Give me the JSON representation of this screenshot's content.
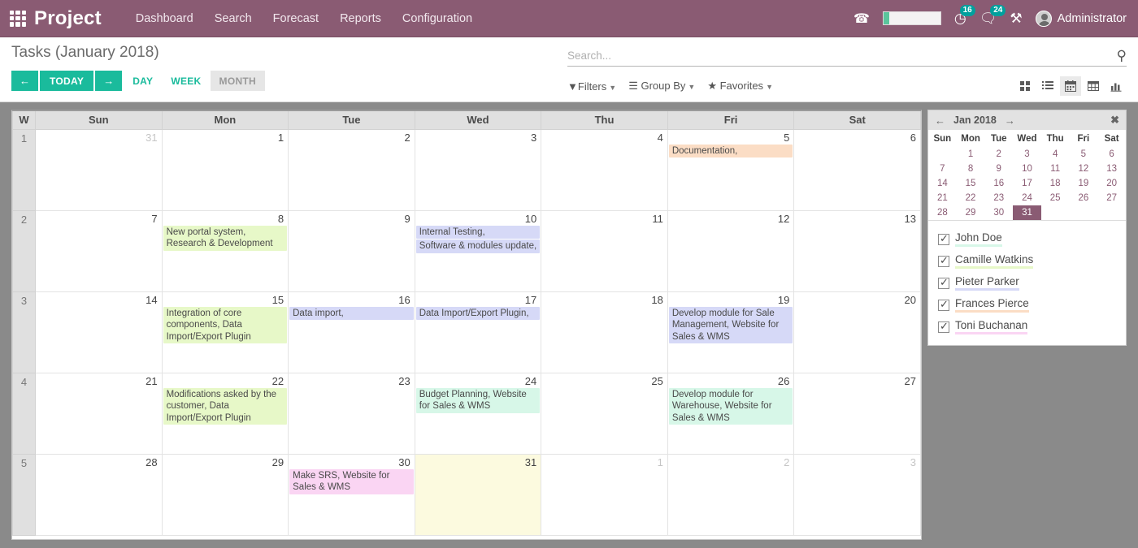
{
  "navbar": {
    "apps_icon": "apps-grid-icon",
    "brand": "Project",
    "links": [
      {
        "label": "Dashboard"
      },
      {
        "label": "Search"
      },
      {
        "label": "Forecast"
      },
      {
        "label": "Reports"
      },
      {
        "label": "Configuration"
      }
    ],
    "phone_icon": "phone-icon",
    "progress": {
      "percent": 10
    },
    "activity": {
      "icon": "clock-icon",
      "count": "16"
    },
    "messages": {
      "icon": "chat-icon",
      "count": "24"
    },
    "tools_icon": "tools-icon",
    "user": "Administrator",
    "brand_color": "#8a5b73",
    "badge_color": "#00a09d"
  },
  "control": {
    "title": "Tasks (January 2018)",
    "prev_label": "←",
    "today_label": "TODAY",
    "next_label": "→",
    "scales": [
      {
        "label": "DAY",
        "active": false
      },
      {
        "label": "WEEK",
        "active": false
      },
      {
        "label": "MONTH",
        "active": true
      }
    ],
    "accent_color": "#1abb9c",
    "search": {
      "placeholder": "Search...",
      "value": "",
      "icon": "search-icon"
    },
    "filters": [
      {
        "label": "Filters",
        "icon": "filter-icon"
      },
      {
        "label": "Group By",
        "icon": "hamburger-icon"
      },
      {
        "label": "Favorites",
        "icon": "star-icon"
      }
    ],
    "views": [
      {
        "name": "kanban",
        "active": false
      },
      {
        "name": "list",
        "active": false
      },
      {
        "name": "calendar",
        "active": true
      },
      {
        "name": "pivot",
        "active": false
      },
      {
        "name": "graph",
        "active": false
      }
    ]
  },
  "calendar": {
    "week_header": "W",
    "day_headers": [
      "Sun",
      "Mon",
      "Tue",
      "Wed",
      "Thu",
      "Fri",
      "Sat"
    ],
    "colors": {
      "mint": "#d7f7e8",
      "green": "#e7f8c8",
      "lavender": "#d6d9f7",
      "peach": "#fbddc5",
      "pink": "#fad5f3",
      "today_bg": "#fcfadf"
    },
    "weeks": [
      {
        "week": "1",
        "days": [
          {
            "num": "31",
            "other": true,
            "today": false,
            "events": []
          },
          {
            "num": "1",
            "other": false,
            "today": false,
            "events": []
          },
          {
            "num": "2",
            "other": false,
            "today": false,
            "events": []
          },
          {
            "num": "3",
            "other": false,
            "today": false,
            "events": []
          },
          {
            "num": "4",
            "other": false,
            "today": false,
            "events": []
          },
          {
            "num": "5",
            "other": false,
            "today": false,
            "events": [
              {
                "text": "Documentation,",
                "color": "peach"
              }
            ]
          },
          {
            "num": "6",
            "other": false,
            "today": false,
            "events": []
          }
        ]
      },
      {
        "week": "2",
        "days": [
          {
            "num": "7",
            "other": false,
            "today": false,
            "events": []
          },
          {
            "num": "8",
            "other": false,
            "today": false,
            "events": [
              {
                "text": "New portal system, Research & Development",
                "color": "green"
              }
            ]
          },
          {
            "num": "9",
            "other": false,
            "today": false,
            "events": []
          },
          {
            "num": "10",
            "other": false,
            "today": false,
            "events": [
              {
                "text": "Internal Testing,",
                "color": "lavender"
              },
              {
                "text": "Software & modules update,",
                "color": "lavender"
              }
            ]
          },
          {
            "num": "11",
            "other": false,
            "today": false,
            "events": []
          },
          {
            "num": "12",
            "other": false,
            "today": false,
            "events": []
          },
          {
            "num": "13",
            "other": false,
            "today": false,
            "events": []
          }
        ]
      },
      {
        "week": "3",
        "days": [
          {
            "num": "14",
            "other": false,
            "today": false,
            "events": []
          },
          {
            "num": "15",
            "other": false,
            "today": false,
            "events": [
              {
                "text": "Integration of core components, Data Import/Export Plugin",
                "color": "green"
              }
            ]
          },
          {
            "num": "16",
            "other": false,
            "today": false,
            "events": [
              {
                "text": "Data import,",
                "color": "lavender"
              }
            ]
          },
          {
            "num": "17",
            "other": false,
            "today": false,
            "events": [
              {
                "text": "Data Import/Export Plugin,",
                "color": "lavender"
              }
            ]
          },
          {
            "num": "18",
            "other": false,
            "today": false,
            "events": []
          },
          {
            "num": "19",
            "other": false,
            "today": false,
            "events": [
              {
                "text": "Develop module for Sale Management, Website for Sales & WMS",
                "color": "lavender"
              }
            ]
          },
          {
            "num": "20",
            "other": false,
            "today": false,
            "events": []
          }
        ]
      },
      {
        "week": "4",
        "days": [
          {
            "num": "21",
            "other": false,
            "today": false,
            "events": []
          },
          {
            "num": "22",
            "other": false,
            "today": false,
            "events": [
              {
                "text": "Modifications asked by the customer, Data Import/Export Plugin",
                "color": "green"
              }
            ]
          },
          {
            "num": "23",
            "other": false,
            "today": false,
            "events": []
          },
          {
            "num": "24",
            "other": false,
            "today": false,
            "events": [
              {
                "text": "Budget Planning, Website for Sales & WMS",
                "color": "mint"
              }
            ]
          },
          {
            "num": "25",
            "other": false,
            "today": false,
            "events": []
          },
          {
            "num": "26",
            "other": false,
            "today": false,
            "events": [
              {
                "text": "Develop module for Warehouse, Website for Sales & WMS",
                "color": "mint"
              }
            ]
          },
          {
            "num": "27",
            "other": false,
            "today": false,
            "events": []
          }
        ]
      },
      {
        "week": "5",
        "days": [
          {
            "num": "28",
            "other": false,
            "today": false,
            "events": []
          },
          {
            "num": "29",
            "other": false,
            "today": false,
            "events": []
          },
          {
            "num": "30",
            "other": false,
            "today": false,
            "events": [
              {
                "text": "Make SRS, Website for Sales & WMS",
                "color": "pink"
              }
            ]
          },
          {
            "num": "31",
            "other": false,
            "today": true,
            "events": []
          },
          {
            "num": "1",
            "other": true,
            "today": false,
            "events": []
          },
          {
            "num": "2",
            "other": true,
            "today": false,
            "events": []
          },
          {
            "num": "3",
            "other": true,
            "today": false,
            "events": []
          }
        ]
      }
    ]
  },
  "side_panel": {
    "mini": {
      "prev_icon": "arrow-left-icon",
      "title": "Jan 2018",
      "next_icon": "arrow-right-icon",
      "close_icon": "close-icon",
      "day_headers": [
        "Sun",
        "Mon",
        "Tue",
        "Wed",
        "Thu",
        "Fri",
        "Sat"
      ],
      "selected": "31",
      "rows": [
        [
          "",
          "1",
          "2",
          "3",
          "4",
          "5",
          "6"
        ],
        [
          "7",
          "8",
          "9",
          "10",
          "11",
          "12",
          "13"
        ],
        [
          "14",
          "15",
          "16",
          "17",
          "18",
          "19",
          "20"
        ],
        [
          "21",
          "22",
          "23",
          "24",
          "25",
          "26",
          "27"
        ],
        [
          "28",
          "29",
          "30",
          "31",
          "",
          "",
          ""
        ]
      ]
    },
    "users": [
      {
        "name": "John Doe",
        "color": "#d7f7e8",
        "checked": true
      },
      {
        "name": "Camille Watkins",
        "color": "#e7f8c8",
        "checked": true
      },
      {
        "name": "Pieter Parker",
        "color": "#d6d9f7",
        "checked": true
      },
      {
        "name": "Frances Pierce",
        "color": "#fbddc5",
        "checked": true
      },
      {
        "name": "Toni Buchanan",
        "color": "#fad5f3",
        "checked": true
      }
    ]
  }
}
